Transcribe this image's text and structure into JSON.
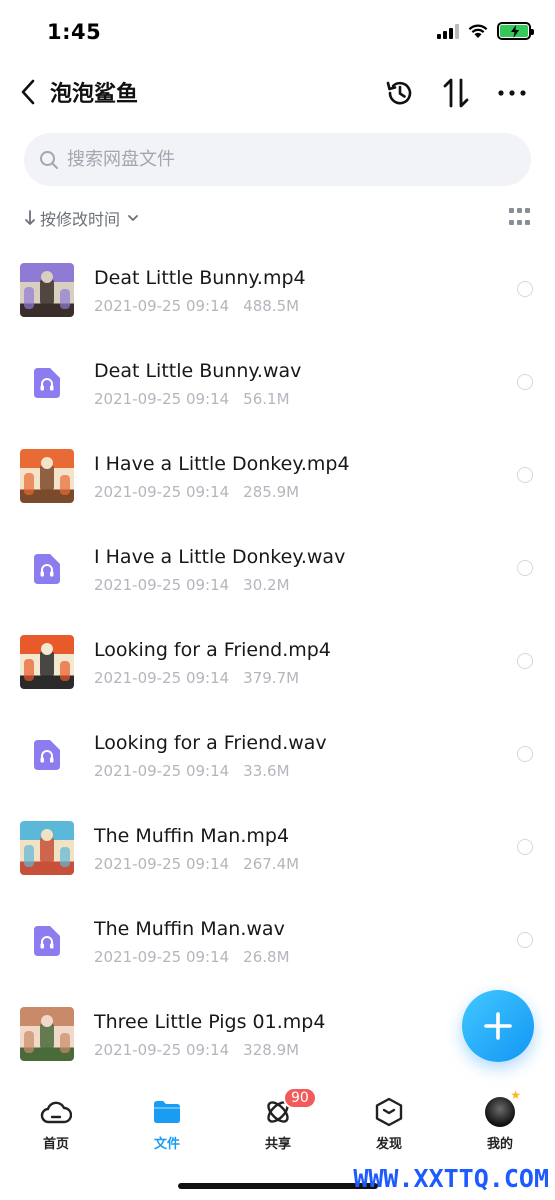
{
  "status_bar": {
    "time": "1:45",
    "battery_color": "#34c759"
  },
  "header": {
    "title": "泡泡鲨鱼",
    "icons": [
      "back-icon",
      "history-icon",
      "transfer-icon",
      "more-icon"
    ]
  },
  "search": {
    "placeholder": "搜索网盘文件"
  },
  "sort": {
    "label": "按修改时间",
    "view_icon": "grid-view-icon"
  },
  "files": [
    {
      "name": "Deat Little Bunny.mp4",
      "date": "2021-09-25 09:14",
      "size": "488.5M",
      "type": "video",
      "thumb_colors": [
        "#8f7bd6",
        "#d9cfc0",
        "#3a2e2a"
      ]
    },
    {
      "name": "Deat Little Bunny.wav",
      "date": "2021-09-25 09:14",
      "size": "56.1M",
      "type": "audio"
    },
    {
      "name": "I Have a Little Donkey.mp4",
      "date": "2021-09-25 09:14",
      "size": "285.9M",
      "type": "video",
      "thumb_colors": [
        "#e86a34",
        "#f4e3c8",
        "#7a4a2a"
      ]
    },
    {
      "name": "I Have a Little Donkey.wav",
      "date": "2021-09-25 09:14",
      "size": "30.2M",
      "type": "audio"
    },
    {
      "name": "Looking for a Friend.mp4",
      "date": "2021-09-25 09:14",
      "size": "379.7M",
      "type": "video",
      "thumb_colors": [
        "#e85a2a",
        "#f3e9d0",
        "#2a2a2a"
      ]
    },
    {
      "name": "Looking for a Friend.wav",
      "date": "2021-09-25 09:14",
      "size": "33.6M",
      "type": "audio"
    },
    {
      "name": "The Muffin Man.mp4",
      "date": "2021-09-25 09:14",
      "size": "267.4M",
      "type": "video",
      "thumb_colors": [
        "#5bb8d9",
        "#f2e2c4",
        "#c8503a"
      ]
    },
    {
      "name": "The Muffin Man.wav",
      "date": "2021-09-25 09:14",
      "size": "26.8M",
      "type": "audio"
    },
    {
      "name": "Three Little Pigs 01.mp4",
      "date": "2021-09-25 09:14",
      "size": "328.9M",
      "type": "video",
      "thumb_colors": [
        "#c98a6a",
        "#f1d9c9",
        "#4a6a3a"
      ]
    }
  ],
  "fab": {
    "icon": "plus-icon"
  },
  "tabs": [
    {
      "label": "首页",
      "icon": "cloud-icon",
      "active": false
    },
    {
      "label": "文件",
      "icon": "folder-icon",
      "active": true
    },
    {
      "label": "共享",
      "icon": "share-orbit-icon",
      "active": false,
      "badge": "90"
    },
    {
      "label": "发现",
      "icon": "discover-box-icon",
      "active": false
    },
    {
      "label": "我的",
      "icon": "avatar-icon",
      "active": false
    }
  ],
  "watermark": "WWW.XXTTQ.COM",
  "accent_color": "#1a9cf2",
  "audio_icon_color": "#8b7cf0"
}
